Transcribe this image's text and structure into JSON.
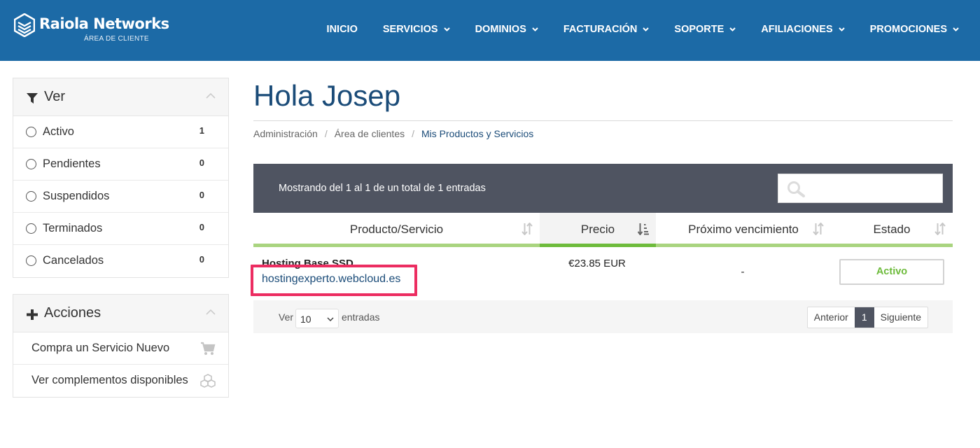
{
  "brand": {
    "name": "Raiola Networks",
    "subtitle": "ÁREA DE CLIENTE"
  },
  "nav": [
    {
      "label": "INICIO",
      "dropdown": false
    },
    {
      "label": "SERVICIOS",
      "dropdown": true
    },
    {
      "label": "DOMINIOS",
      "dropdown": true
    },
    {
      "label": "FACTURACIÓN",
      "dropdown": true
    },
    {
      "label": "SOPORTE",
      "dropdown": true
    },
    {
      "label": "AFILIACIONES",
      "dropdown": true
    },
    {
      "label": "PROMOCIONES",
      "dropdown": true
    }
  ],
  "sidebar": {
    "filter_panel": {
      "title": "Ver",
      "icon": "filter-icon",
      "items": [
        {
          "label": "Activo",
          "count": "1"
        },
        {
          "label": "Pendientes",
          "count": "0"
        },
        {
          "label": "Suspendidos",
          "count": "0"
        },
        {
          "label": "Terminados",
          "count": "0"
        },
        {
          "label": "Cancelados",
          "count": "0"
        }
      ]
    },
    "actions_panel": {
      "title": "Acciones",
      "icon": "plus-icon",
      "items": [
        {
          "label": "Compra un Servicio Nuevo",
          "icon": "cart-icon"
        },
        {
          "label": "Ver complementos disponibles",
          "icon": "cubes-icon"
        }
      ]
    }
  },
  "main": {
    "title": "Hola Josep",
    "breadcrumb": [
      "Administración",
      "Área de clientes",
      "Mis Productos y Servicios"
    ],
    "table": {
      "info": "Mostrando del 1 al 1 de un total de 1 entradas",
      "search_placeholder": "",
      "columns": [
        "Producto/Servicio",
        "Precio",
        "Próximo vencimiento",
        "Estado"
      ],
      "rows": [
        {
          "product": "Hosting Base SSD",
          "domain": "hostingexperto.webcloud.es",
          "price": "€23.85 EUR",
          "due": "-",
          "status": "Activo"
        }
      ],
      "footer": {
        "show_label": "Ver",
        "page_length": "10",
        "entries_label": "entradas",
        "prev": "Anterior",
        "current_page": "1",
        "next": "Siguiente"
      }
    }
  },
  "colors": {
    "header": "#1c6aa6",
    "title": "#1a4b78",
    "table_bar": "#4f5461",
    "accent_green": "#6dbb3b",
    "highlight": "#ec2d61"
  }
}
